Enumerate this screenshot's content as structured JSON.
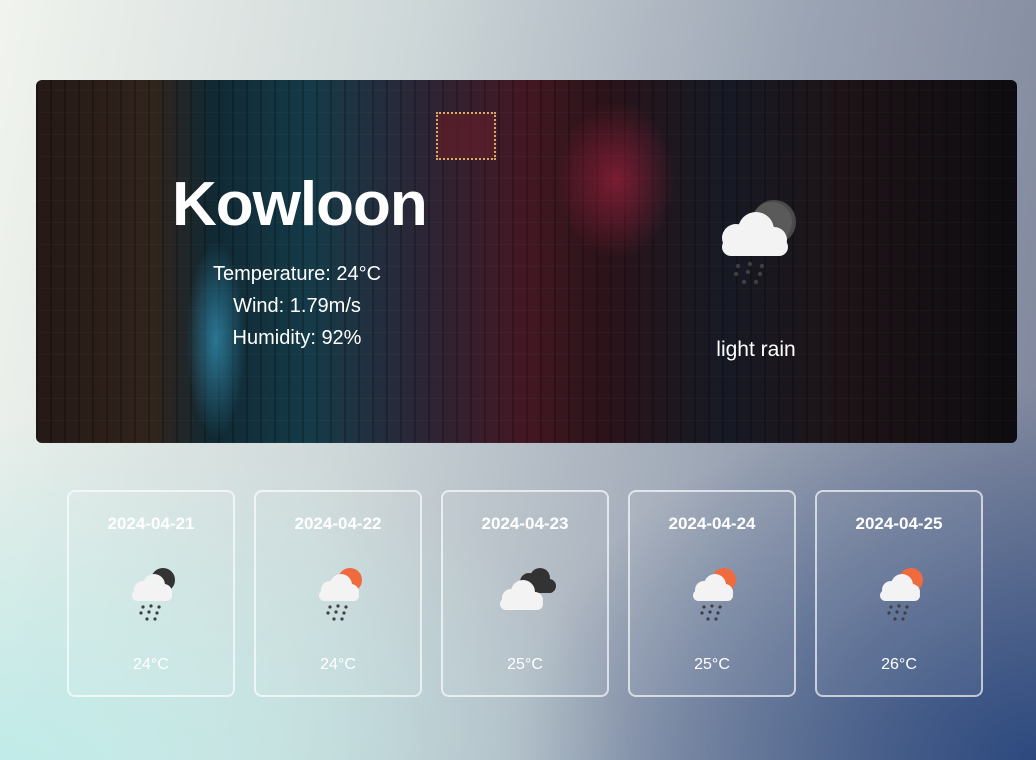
{
  "current": {
    "city": "Kowloon",
    "temperature_text": "Temperature: 24°C",
    "wind_text": "Wind: 1.79m/s",
    "humidity_text": "Humidity: 92%",
    "description": "light rain",
    "icon": "dark-cloud-rain-icon"
  },
  "forecast": [
    {
      "date": "2024-04-21",
      "temp": "24°C",
      "icon": "dark-cloud-rain-icon"
    },
    {
      "date": "2024-04-22",
      "temp": "24°C",
      "icon": "sun-cloud-rain-icon"
    },
    {
      "date": "2024-04-23",
      "temp": "25°C",
      "icon": "broken-clouds-icon"
    },
    {
      "date": "2024-04-24",
      "temp": "25°C",
      "icon": "sun-cloud-rain-icon"
    },
    {
      "date": "2024-04-25",
      "temp": "26°C",
      "icon": "sun-cloud-rain-icon"
    }
  ],
  "colors": {
    "text": "#ffffff",
    "sun": "#ef6a3d",
    "dark_cloud": "#3a3a3a",
    "light_cloud": "#f3f3f3"
  }
}
